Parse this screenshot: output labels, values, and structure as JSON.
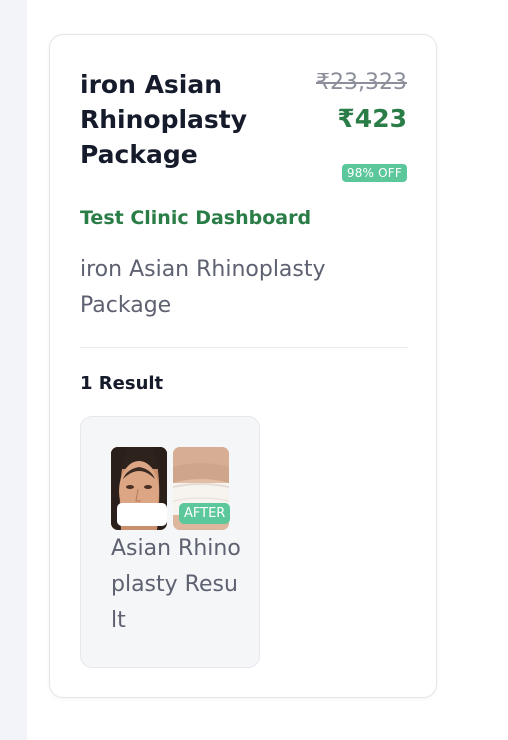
{
  "package": {
    "title": "iron Asian Rhinoplasty Package",
    "original_price": "₹23,323",
    "price": "₹423",
    "discount": "98% OFF",
    "clinic": "Test Clinic Dashboard",
    "description": "iron Asian Rhinoplasty Package"
  },
  "results": {
    "count_label": "1 Result",
    "items": [
      {
        "title": "Asian Rhinoplasty Result",
        "after_label": "AFTER",
        "before_icon": "face-photo-icon",
        "after_icon": "chest-photo-icon"
      }
    ]
  },
  "colors": {
    "accent_green": "#2a7d46",
    "badge_green": "#5bc79a",
    "title_dark": "#161b2b",
    "muted_text": "#5d6170",
    "strike_gray": "#8b8f99"
  }
}
